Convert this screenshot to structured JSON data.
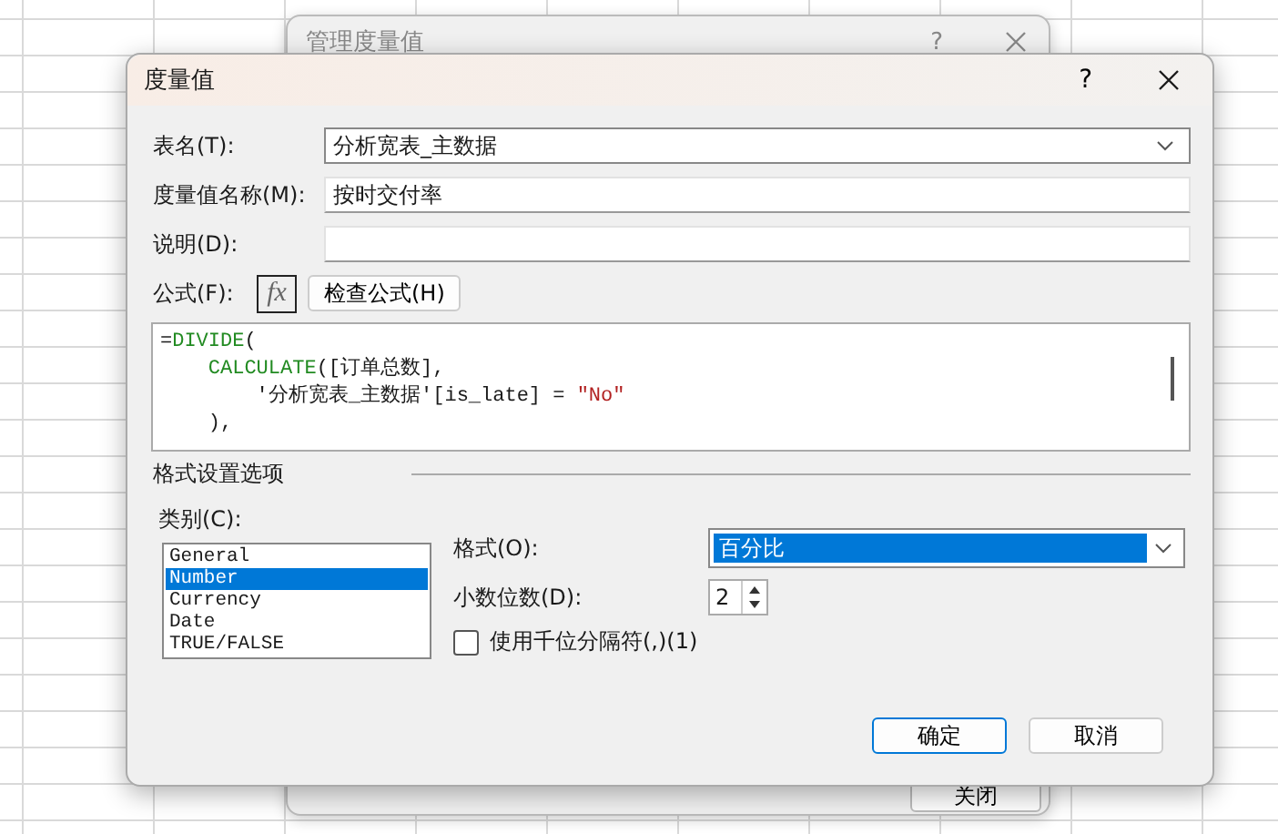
{
  "background_window": {
    "title": "管理度量值",
    "help": "?",
    "close_button": "关闭"
  },
  "dialog": {
    "title": "度量值",
    "help": "?"
  },
  "fields": {
    "table_name": {
      "label": "表名(T):",
      "value": "分析宽表_主数据"
    },
    "measure_name": {
      "label": "度量值名称(M):",
      "value": "按时交付率"
    },
    "description": {
      "label": "说明(D):"
    },
    "formula": {
      "label": "公式(F):",
      "fx": "fx",
      "check_button": "检查公式(H)",
      "lines": [
        [
          {
            "text": "=",
            "kind": "plain"
          },
          {
            "text": "DIVIDE",
            "kind": "function"
          },
          {
            "text": "(",
            "kind": "plain"
          }
        ],
        [
          {
            "text": "    CALCULATE",
            "kind": "function"
          },
          {
            "text": "([订单总数],",
            "kind": "plain"
          }
        ],
        [
          {
            "text": "        '分析宽表_主数据'[is_late] = ",
            "kind": "plain"
          },
          {
            "text": "\"No\"",
            "kind": "string"
          }
        ],
        [
          {
            "text": "    ),",
            "kind": "plain"
          }
        ]
      ]
    }
  },
  "format": {
    "title": "格式设置选项",
    "category_label": "类别(C):",
    "categories": [
      {
        "label": "General",
        "selected": false
      },
      {
        "label": "Number",
        "selected": true
      },
      {
        "label": "Currency",
        "selected": false
      },
      {
        "label": "Date",
        "selected": false
      },
      {
        "label": "TRUE/FALSE",
        "selected": false
      }
    ],
    "format_label": "格式(O):",
    "format_value": "百分比",
    "decimals_label": "小数位数(D):",
    "decimals_value": "2",
    "thousands": {
      "label": "使用千位分隔符(,)(1)",
      "checked": false
    }
  },
  "buttons": [
    {
      "label": "确定",
      "default": true
    },
    {
      "label": "取消",
      "default": false
    }
  ]
}
